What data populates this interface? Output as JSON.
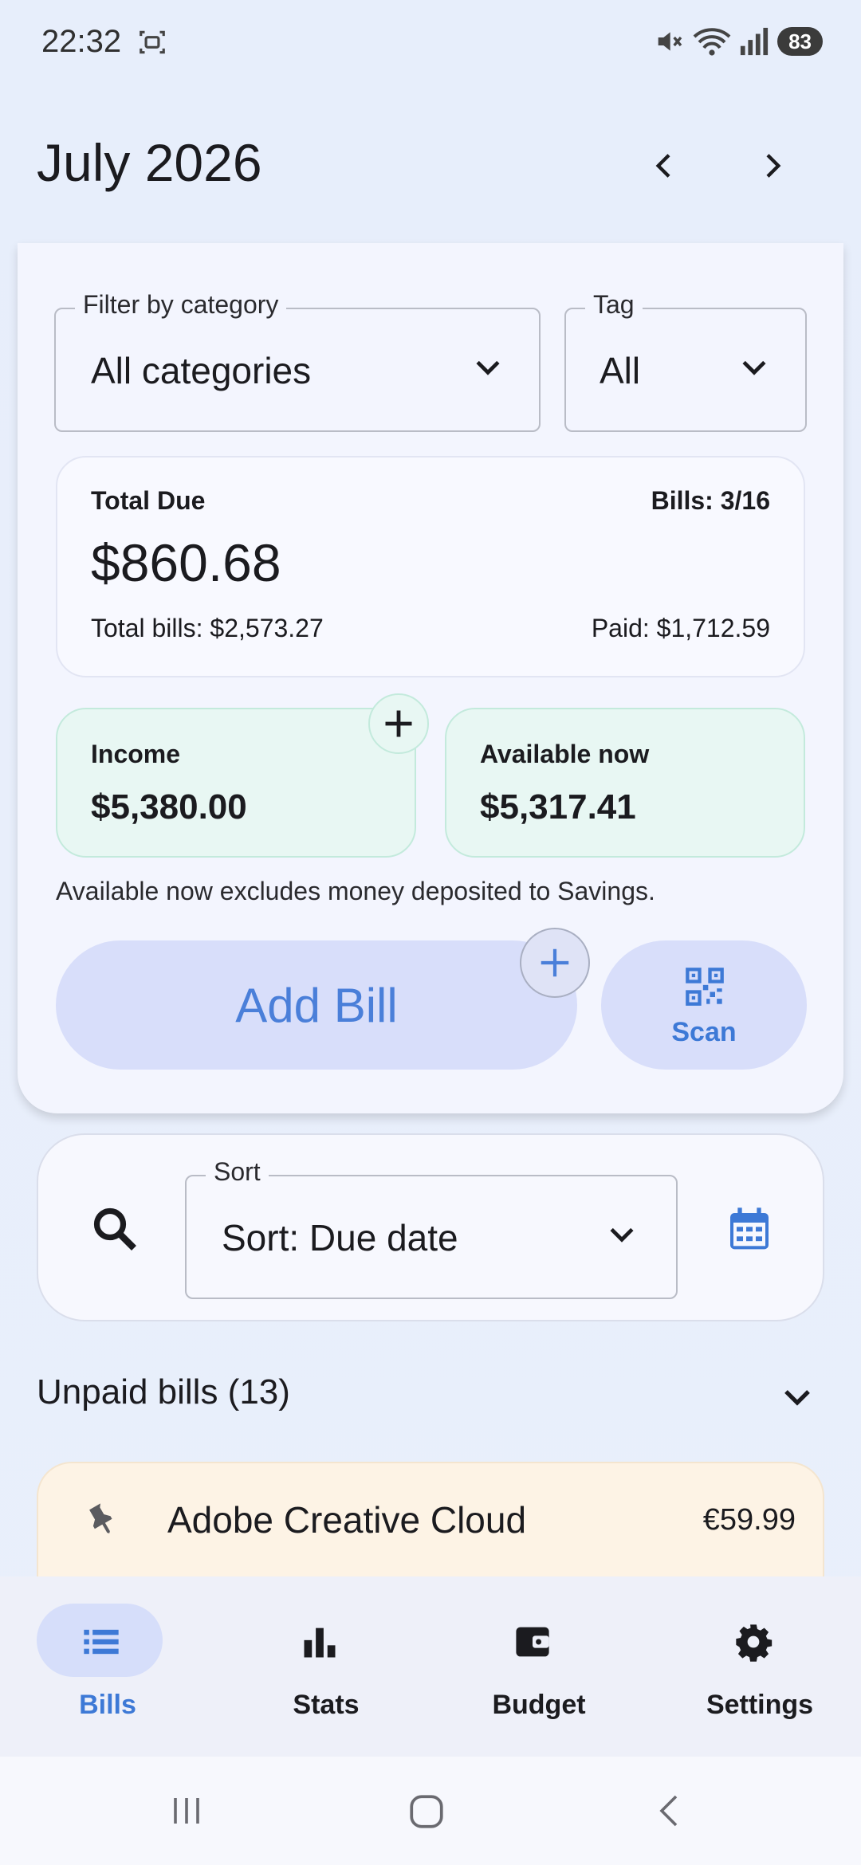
{
  "status_bar": {
    "time": "22:32",
    "battery": "83"
  },
  "header": {
    "month": "July 2026"
  },
  "filters": {
    "category_legend": "Filter by category",
    "category_value": "All categories",
    "tag_legend": "Tag",
    "tag_value": "All"
  },
  "summary": {
    "total_due_label": "Total Due",
    "bills_count": "Bills: 3/16",
    "total_due": "$860.68",
    "total_bills": "Total bills: $2,573.27",
    "paid": "Paid: $1,712.59"
  },
  "income": {
    "label": "Income",
    "amount": "$5,380.00"
  },
  "available": {
    "label": "Available now",
    "amount": "$5,317.41"
  },
  "note": "Available now excludes money deposited to Savings.",
  "actions": {
    "add_bill": "Add Bill",
    "scan": "Scan"
  },
  "sort": {
    "legend": "Sort",
    "value": "Sort: Due date"
  },
  "unpaid": {
    "title": "Unpaid bills (13)"
  },
  "bills": [
    {
      "name": "Adobe Creative Cloud",
      "price": "€59.99"
    }
  ],
  "bottom_nav": [
    {
      "label": "Bills",
      "icon": "list-icon",
      "active": true
    },
    {
      "label": "Stats",
      "icon": "bar-chart-icon",
      "active": false
    },
    {
      "label": "Budget",
      "icon": "wallet-icon",
      "active": false
    },
    {
      "label": "Settings",
      "icon": "gear-icon",
      "active": false
    }
  ],
  "colors": {
    "accent": "#4a7fd9",
    "active_pill": "#d6defa",
    "bill_bg": "#fdf3e5",
    "mint": "#e8f7f3"
  }
}
